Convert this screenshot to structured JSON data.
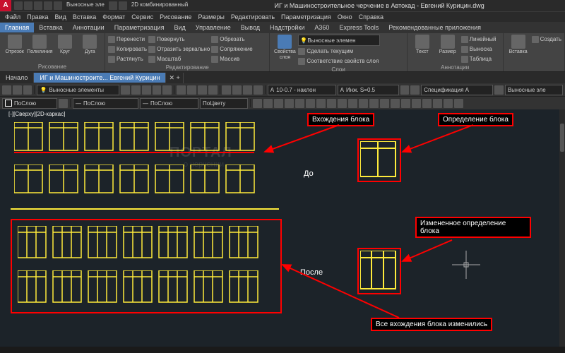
{
  "app": {
    "letter": "A",
    "doc_title": "ИГ и Машиностроительное черчение в Автокад - Евгений Курицин.dwg"
  },
  "qat": {
    "text1": "Выносные эле",
    "text2": "2D комбинированный"
  },
  "menu": [
    "Файл",
    "Правка",
    "Вид",
    "Вставка",
    "Формат",
    "Сервис",
    "Рисование",
    "Размеры",
    "Редактировать",
    "Параметризация",
    "Окно",
    "Справка"
  ],
  "ribbon_tabs": [
    "Главная",
    "Вставка",
    "Аннотации",
    "Параметризация",
    "Вид",
    "Управление",
    "Вывод",
    "Надстройки",
    "A360",
    "Express Tools",
    "Рекомендованные приложения"
  ],
  "panels": {
    "draw": {
      "label": "Рисование",
      "b1": "Отрезок",
      "b2": "Полилиния",
      "b3": "Круг",
      "b4": "Дуга"
    },
    "modify": {
      "label": "Редактирование",
      "r1": "Перенести",
      "r2": "Копировать",
      "r3": "Растянуть",
      "r4": "Повернуть",
      "r5": "Отразить зеркально",
      "r6": "Масштаб",
      "r7": "Обрезать",
      "r8": "Сопряжение",
      "r9": "Массив"
    },
    "layers": {
      "label": "Слои",
      "main": "Свойства слоя",
      "combo": "Выносные элемен",
      "r1": "Сделать текущим",
      "r2": "Соответствие свойств слоя"
    },
    "annot": {
      "label": "Аннотации",
      "b1": "Текст",
      "b2": "Размер",
      "r1": "Линейный",
      "r2": "Выноска",
      "r3": "Таблица"
    },
    "block": {
      "label": "",
      "b1": "Вставка",
      "r1": "Создать"
    }
  },
  "doctabs": {
    "t1": "Начало",
    "t2": "ИГ и Машиностроите... Евгений Курицин"
  },
  "props": {
    "layer": "ПоСлою",
    "color": "ПоСлою",
    "ltype": "ПоСлою",
    "lweight": "ПоЦвету"
  },
  "tb": {
    "combo1": "Выносные элементы",
    "combo2": "10-0.7 - наклон",
    "combo3": "Инж. S=0.5",
    "combo4": "Спецификация A",
    "combo5": "Выносные эле"
  },
  "view": {
    "label": "[-][Сверху][2D-каркас]"
  },
  "callouts": {
    "c1": "Вхождения блока",
    "c2": "Определение блока",
    "c3": "Измененное определение блока",
    "c4": "Все вхождения блока изменились",
    "before": "До",
    "after": "После"
  }
}
